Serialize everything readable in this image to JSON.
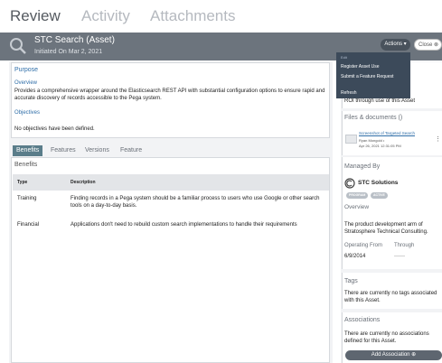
{
  "nav": {
    "tabs": [
      {
        "label": "Review"
      },
      {
        "label": "Activity"
      },
      {
        "label": "Attachments"
      }
    ]
  },
  "header": {
    "title": "STC Search (Asset)",
    "subtitle": "Initiated On  Mar 2, 2021",
    "actions_label": "Actions ▾",
    "close_label": "Close ⊗"
  },
  "actions_menu": {
    "group": "Edit",
    "items": [
      "Register Asset Use",
      "Submit a Feature Request",
      "Refresh"
    ]
  },
  "purpose": {
    "heading": "Purpose",
    "overview_label": "Overview",
    "overview_text": "Provides a comprehensive wrapper around the Elasticsearch REST API with substantial configuration options to ensure rapid and accurate discovery of records accessible to the Pega system.",
    "objectives_label": "Objectives",
    "objectives_text": "No objectives have been defined."
  },
  "tabs": [
    "Benefits",
    "Features",
    "Versions",
    "Feature Requests"
  ],
  "benefits": {
    "heading": "Benefits",
    "columns": [
      "Type",
      "Description"
    ],
    "rows": [
      {
        "type": "Training",
        "description": "Finding records in a Pega system should be a familiar process to users who use Google or other search tools on a day-to-day basis."
      },
      {
        "type": "Financial",
        "description": "Applications don't need to rebuild custom search implementations to handle their requirements"
      }
    ]
  },
  "right": {
    "roi_text": "ROI through use of this Asset",
    "files_heading": "Files & documents ()",
    "file_name": "Screenshot of Targeted Search",
    "file_author": "Ryan Mongold •",
    "file_date": "Apr 26, 2021 12:31:05 PM",
    "managed_by_heading": "Managed By",
    "org_name": "STC Solutions",
    "badges": [
      "PROGRAM",
      "ACTIVE"
    ],
    "overview_label": "Overview",
    "overview_text": "The product development arm of Stratosphere Technical Consulting.",
    "operating_from_label": "Operating From",
    "through_label": "Through",
    "operating_from_value": "6/9/2014",
    "through_value": "——",
    "tags_heading": "Tags",
    "tags_text": "There are currently no tags associated with this Asset.",
    "assoc_heading": "Associations",
    "assoc_text": "There are currently no associations defined for this Asset.",
    "add_assoc_label": "Add Association ⊕"
  }
}
